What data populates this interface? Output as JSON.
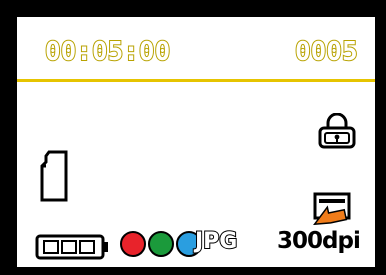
{
  "display": {
    "timer": "00:05:00",
    "counter": "0005",
    "image_format": "JPG",
    "resolution": "300dpi"
  },
  "icons": {
    "lock": "lock-icon",
    "sd_card": "sd-card-icon",
    "transfer": "transfer-icon",
    "battery": "battery-icon",
    "color_mode": "rgb-color-icon"
  },
  "battery": {
    "level": 1.0
  },
  "color_mode": {
    "channels": [
      "red",
      "green",
      "blue"
    ]
  },
  "colors": {
    "frame": "#000000",
    "screen_background": "#ffffff",
    "segment_outline": "#b8a200",
    "divider": "#e6c400",
    "red": "#e8232b",
    "green": "#1b9a3b",
    "blue": "#2a9ee0",
    "transfer_arrow": "#f07c1a"
  }
}
